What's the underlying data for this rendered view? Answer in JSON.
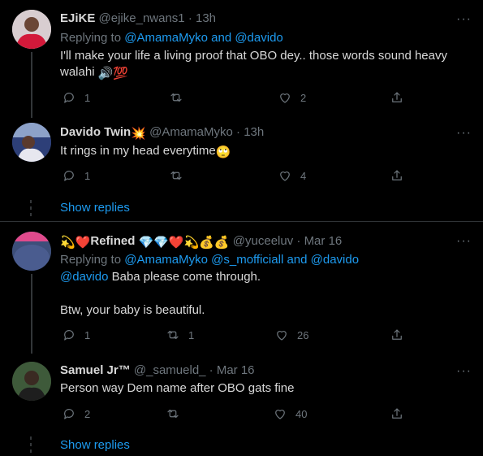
{
  "tweets": [
    {
      "name": "EJiKE",
      "handle": "@ejike_nwans1",
      "time": "13h",
      "replying_prefix": "Replying to",
      "replying_to": "@AmamaMyko and @davido",
      "text_line1": "I'll make your life a living proof that OBO dey.. those words sound heavy",
      "text_line2": "walahi",
      "text_line2_emoji": "🔊💯",
      "replies": "1",
      "retweets": "",
      "likes": "2"
    },
    {
      "name": "Davido Twin",
      "name_emoji": "💥",
      "handle": "@AmamaMyko",
      "time": "13h",
      "text_line1": "It rings in my head everytime",
      "text_line1_emoji": "🙄",
      "replies": "1",
      "retweets": "",
      "likes": "4",
      "show_replies": "Show replies"
    },
    {
      "name_prefix_emoji": "💫❤️",
      "name": "Refined",
      "name_suffix_emoji": "💎💎❤️💫💰💰",
      "handle": "@yuceeluv",
      "time": "Mar 16",
      "replying_prefix": "Replying to",
      "replying_to": "@AmamaMyko @s_mofficiall and @davido",
      "mention": "@davido",
      "text_line1": "Baba please come through.",
      "text_line2": "Btw, your baby is beautiful.",
      "replies": "1",
      "retweets": "1",
      "likes": "26"
    },
    {
      "name": "Samuel Jr™",
      "handle": "@_samueld_",
      "time": "Mar 16",
      "text_line1": "Person way Dem name after OBO gats fine",
      "replies": "2",
      "retweets": "",
      "likes": "40",
      "show_replies": "Show replies"
    }
  ],
  "more_glyph": "···",
  "separator": "·",
  "colors": {
    "background": "#000000",
    "link": "#1d9bf0",
    "muted": "#6e767d",
    "text": "#d9d9d9"
  }
}
